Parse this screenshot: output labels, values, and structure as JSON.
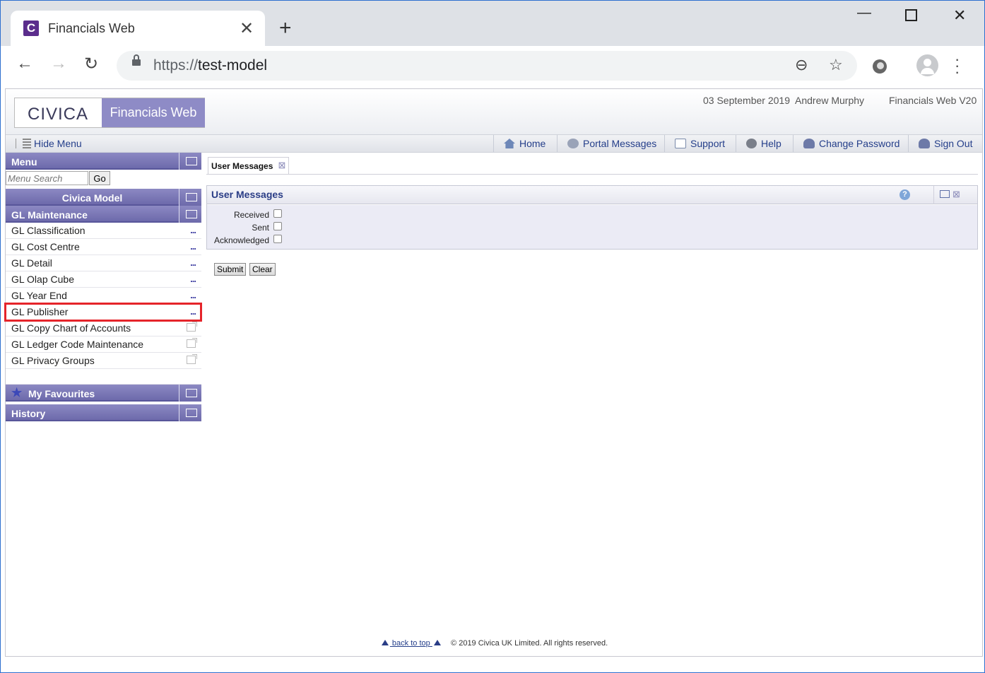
{
  "browser": {
    "tab_title": "Financials Web",
    "favicon_letter": "C",
    "close_tab_glyph": "✕",
    "new_tab_glyph": "+",
    "url_scheme": "https://",
    "url_host": "test-model"
  },
  "header": {
    "logo_civica": "CIVICA",
    "logo_product": "Financials Web",
    "date": "03 September 2019",
    "user": "Andrew Murphy",
    "version": "Financials Web V20"
  },
  "navbar": {
    "hide_menu": "Hide Menu",
    "items": [
      {
        "label": "Home",
        "icon": "home-icon"
      },
      {
        "label": "Portal Messages",
        "icon": "message-icon"
      },
      {
        "label": "Support",
        "icon": "envelope-icon"
      },
      {
        "label": "Help",
        "icon": "help-icon"
      },
      {
        "label": "Change Password",
        "icon": "user-key-icon"
      },
      {
        "label": "Sign Out",
        "icon": "user-signout-icon"
      }
    ]
  },
  "sidebar": {
    "menu_title": "Menu",
    "search_placeholder": "Menu Search",
    "go_label": "Go",
    "model_title": "Civica Model",
    "section_title": "GL Maintenance",
    "items": [
      {
        "label": "GL Classification",
        "marker": "..."
      },
      {
        "label": "GL Cost Centre",
        "marker": "..."
      },
      {
        "label": "GL Detail",
        "marker": "..."
      },
      {
        "label": "GL Olap Cube",
        "marker": "..."
      },
      {
        "label": "GL Year End",
        "marker": "..."
      },
      {
        "label": "GL Publisher",
        "marker": "..."
      },
      {
        "label": "GL Copy Chart of Accounts",
        "marker": "popout"
      },
      {
        "label": "GL Ledger Code Maintenance",
        "marker": "popout"
      },
      {
        "label": "GL Privacy Groups",
        "marker": "popout"
      }
    ],
    "highlighted_item": "GL Publisher",
    "favourites_title": "My Favourites",
    "history_title": "History"
  },
  "content": {
    "tab_label": "User Messages",
    "panel_title": "User Messages",
    "help_glyph": "?",
    "fields": [
      {
        "label": "Received",
        "checked": false
      },
      {
        "label": "Sent",
        "checked": false
      },
      {
        "label": "Acknowledged",
        "checked": false
      }
    ],
    "submit_label": "Submit",
    "clear_label": "Clear"
  },
  "footer": {
    "back_to_top": "back to top",
    "copyright": "© 2019 Civica UK Limited. All rights reserved."
  },
  "colors": {
    "accent_purple": "#8e8bc6",
    "sidebar_bar": "#6d6aab",
    "link_blue": "#243e8a",
    "highlight_red": "#e5242a"
  }
}
